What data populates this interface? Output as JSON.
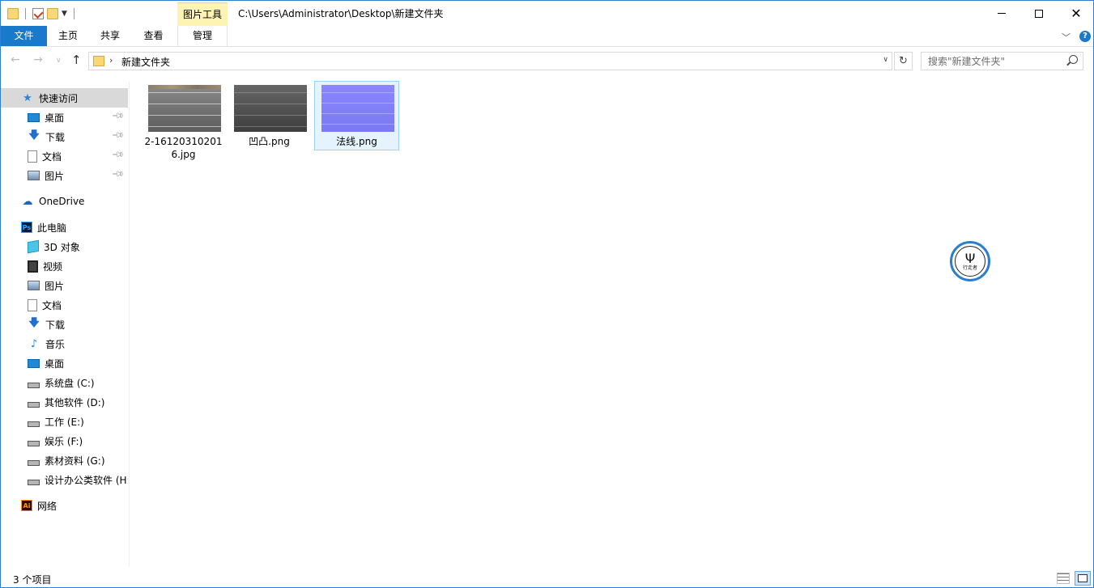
{
  "titlebar": {
    "context_tab": "图片工具",
    "path": "C:\\Users\\Administrator\\Desktop\\新建文件夹",
    "close": "✕"
  },
  "ribbon": {
    "file": "文件",
    "home": "主页",
    "share": "共享",
    "view": "查看",
    "manage": "管理",
    "help": "?"
  },
  "address": {
    "crumb": "新建文件夹",
    "search_placeholder": "搜索\"新建文件夹\""
  },
  "sidebar": {
    "quick_access": "快速访问",
    "quick_items": [
      {
        "label": "桌面",
        "icon": "desktop-icon"
      },
      {
        "label": "下载",
        "icon": "download-icon"
      },
      {
        "label": "文档",
        "icon": "document-icon"
      },
      {
        "label": "图片",
        "icon": "pictures-icon"
      }
    ],
    "onedrive": "OneDrive",
    "this_pc": "此电脑",
    "pc_items": [
      {
        "label": "3D 对象",
        "icon": "3d-objects-icon"
      },
      {
        "label": "视频",
        "icon": "video-icon"
      },
      {
        "label": "图片",
        "icon": "pictures-icon"
      },
      {
        "label": "文档",
        "icon": "document-icon"
      },
      {
        "label": "下载",
        "icon": "download-icon"
      },
      {
        "label": "音乐",
        "icon": "music-icon"
      },
      {
        "label": "桌面",
        "icon": "desktop-icon"
      },
      {
        "label": "系统盘 (C:)",
        "icon": "system-drive-icon"
      },
      {
        "label": "其他软件 (D:)",
        "icon": "drive-icon"
      },
      {
        "label": "工作 (E:)",
        "icon": "drive-icon"
      },
      {
        "label": "娱乐 (F:)",
        "icon": "drive-icon"
      },
      {
        "label": "素材资料 (G:)",
        "icon": "drive-icon"
      },
      {
        "label": "设计办公类软件 (H:",
        "icon": "drive-icon"
      }
    ],
    "network": "网络",
    "ps_badge": "Ps",
    "ai_badge": "Ai"
  },
  "files": [
    {
      "name": "2-161203102016.jpg",
      "name_line1": "2-16120310201",
      "name_line2": "6.jpg"
    },
    {
      "name": "凹凸.png"
    },
    {
      "name": "法线.png"
    }
  ],
  "watermark": {
    "text": "行走者"
  },
  "status": {
    "count": "3 个项目"
  },
  "colors": {
    "accent": "#1979ca",
    "context_tab": "#fdf3b3",
    "selection": "#e5f3ff"
  }
}
